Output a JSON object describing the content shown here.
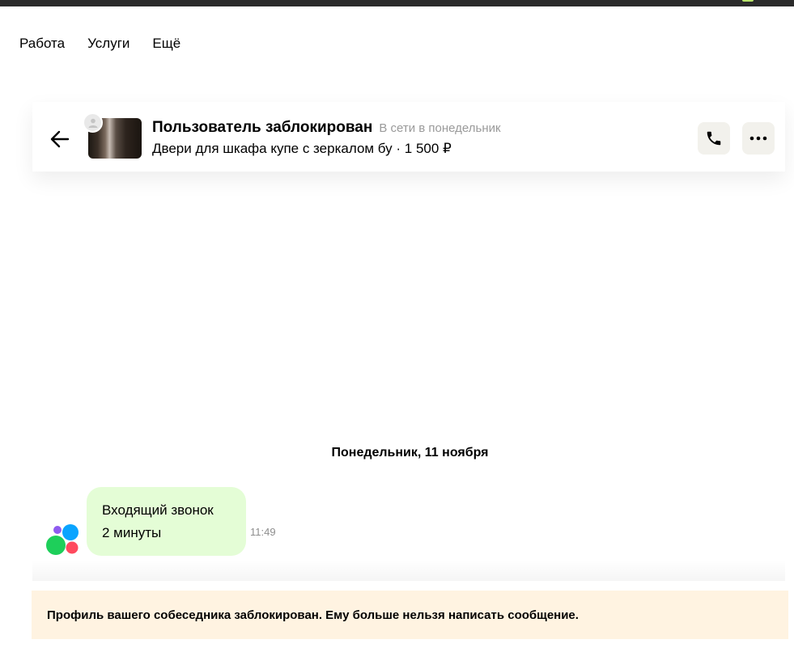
{
  "nav": {
    "items": [
      "Работа",
      "Услуги",
      "Ещё"
    ]
  },
  "chat_header": {
    "user_name": "Пользователь заблокирован",
    "user_status": "В сети в понедельник",
    "listing_title": "Двери для шкафа купе с зеркалом бу · 1 500 ₽"
  },
  "conversation": {
    "date_divider": "Понедельник, 11 ноября",
    "message": {
      "line1": "Входящий звонок",
      "line2": "2 минуты",
      "time": "11:49"
    }
  },
  "banner": {
    "text": "Профиль вашего собеседника заблокирован. Ему больше нельзя написать сообщение."
  },
  "colors": {
    "bubble_bg": "#e4fdd6",
    "banner_bg": "#fff3e1",
    "icon_button_bg": "#f2f1ec",
    "status_gray": "#9a9a9a"
  },
  "icons": [
    "back-arrow-icon",
    "user-placeholder-icon",
    "phone-icon",
    "more-dots-icon",
    "avito-logo-icon"
  ]
}
